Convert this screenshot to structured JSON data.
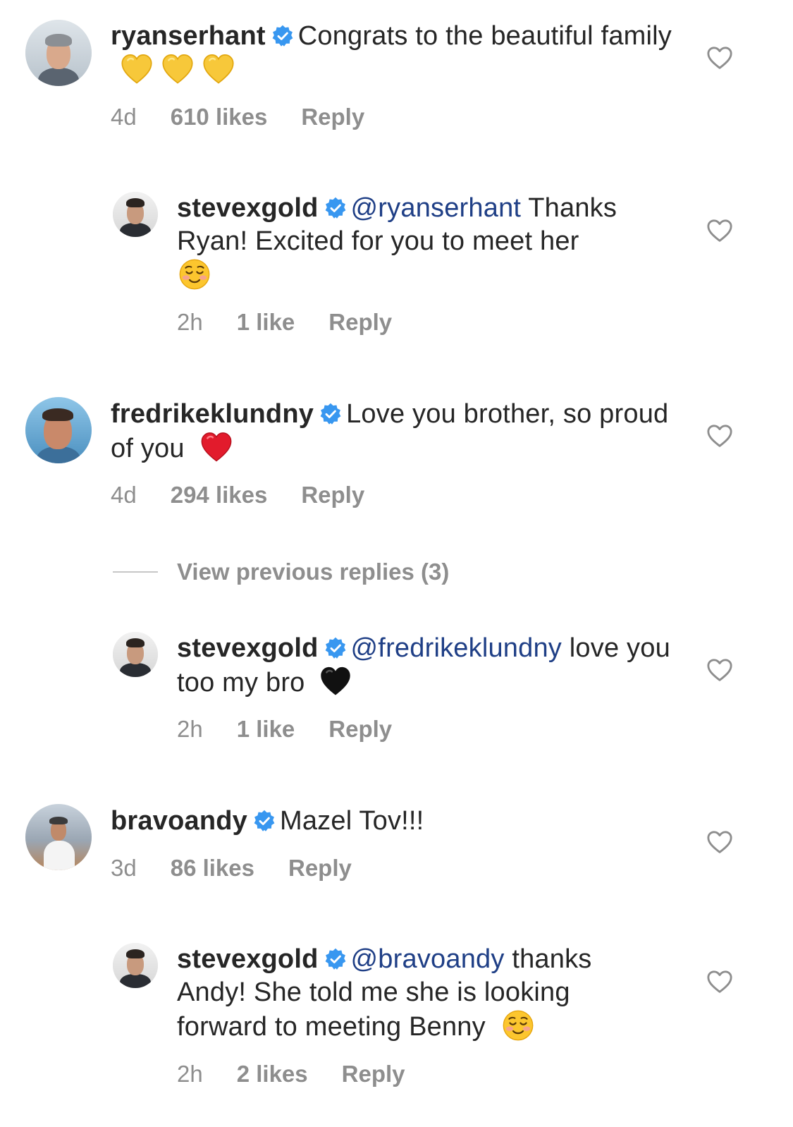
{
  "colors": {
    "text": "#262626",
    "muted": "#8e8e8e",
    "mention": "#1f3f86",
    "verified": "#3897f0",
    "heart_outline": "#8e8e8e"
  },
  "comments": [
    {
      "username": "ryanserhant",
      "verified": true,
      "text": "Congrats to the beautiful family",
      "emoji": [
        "yellow-heart",
        "yellow-heart",
        "yellow-heart"
      ],
      "time": "4d",
      "likes": "610 likes",
      "reply_label": "Reply"
    },
    {
      "username": "stevexgold",
      "verified": true,
      "mention": "@ryanserhant",
      "text": "Thanks Ryan! Excited for you to meet her",
      "emoji": [
        "smiling-face"
      ],
      "time": "2h",
      "likes": "1 like",
      "reply_label": "Reply"
    },
    {
      "username": "fredrikeklundny",
      "verified": true,
      "text": "Love you brother, so proud of you",
      "emoji": [
        "red-heart"
      ],
      "time": "4d",
      "likes": "294 likes",
      "reply_label": "Reply"
    },
    {
      "username": "stevexgold",
      "verified": true,
      "mention": "@fredrikeklundny",
      "text": "love you too my bro",
      "emoji": [
        "black-heart"
      ],
      "time": "2h",
      "likes": "1 like",
      "reply_label": "Reply"
    },
    {
      "username": "bravoandy",
      "verified": true,
      "text": "Mazel Tov!!!",
      "emoji": [],
      "time": "3d",
      "likes": "86 likes",
      "reply_label": "Reply"
    },
    {
      "username": "stevexgold",
      "verified": true,
      "mention": "@bravoandy",
      "text": "thanks Andy! She told me she is looking forward to meeting Benny",
      "emoji": [
        "smiling-face"
      ],
      "time": "2h",
      "likes": "2 likes",
      "reply_label": "Reply"
    }
  ],
  "view_previous_replies": "View previous replies (3)"
}
